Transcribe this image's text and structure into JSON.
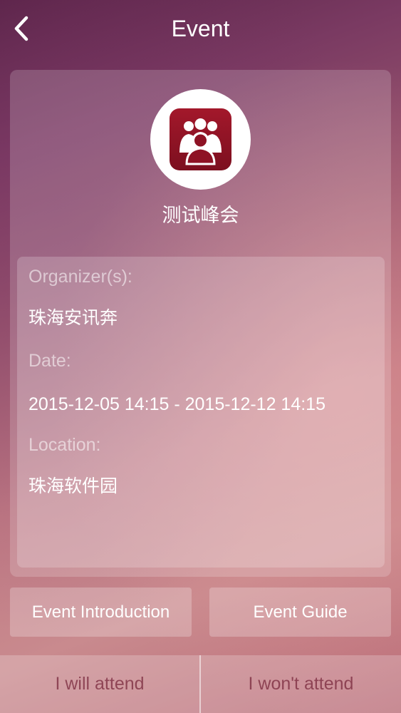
{
  "header": {
    "title": "Event",
    "back_icon": "chevron-left-icon"
  },
  "event": {
    "logo_icon": "people-group-icon",
    "name": "测试峰会"
  },
  "info": {
    "organizer_label": "Organizer(s):",
    "organizer_value": "珠海安讯奔",
    "date_label": "Date:",
    "date_value": "2015-12-05 14:15 - 2015-12-12 14:15",
    "location_label": "Location:",
    "location_value": "珠海软件园"
  },
  "actions": {
    "introduction_label": "Event Introduction",
    "guide_label": "Event Guide"
  },
  "bottom": {
    "attend_label": "I will attend",
    "decline_label": "I won't attend"
  },
  "colors": {
    "logo_red": "#8e1224",
    "text_white": "#ffffff"
  }
}
